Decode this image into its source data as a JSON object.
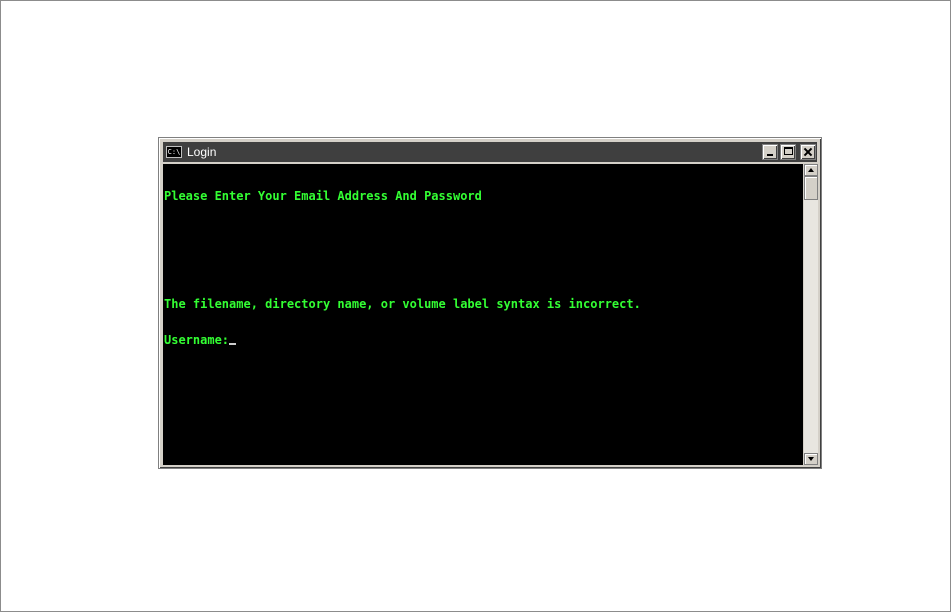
{
  "window": {
    "title": "Login",
    "icon": "cmd-icon",
    "icon_text": "C:\\"
  },
  "console": {
    "lines": [
      "Please Enter Your Email Address And Password",
      "",
      "",
      "The filename, directory name, or volume label syntax is incorrect."
    ],
    "prompt": "Username:"
  },
  "colors": {
    "titlebar": "#3f3f3f",
    "console_background": "#000000",
    "console_text": "#33ff33"
  }
}
